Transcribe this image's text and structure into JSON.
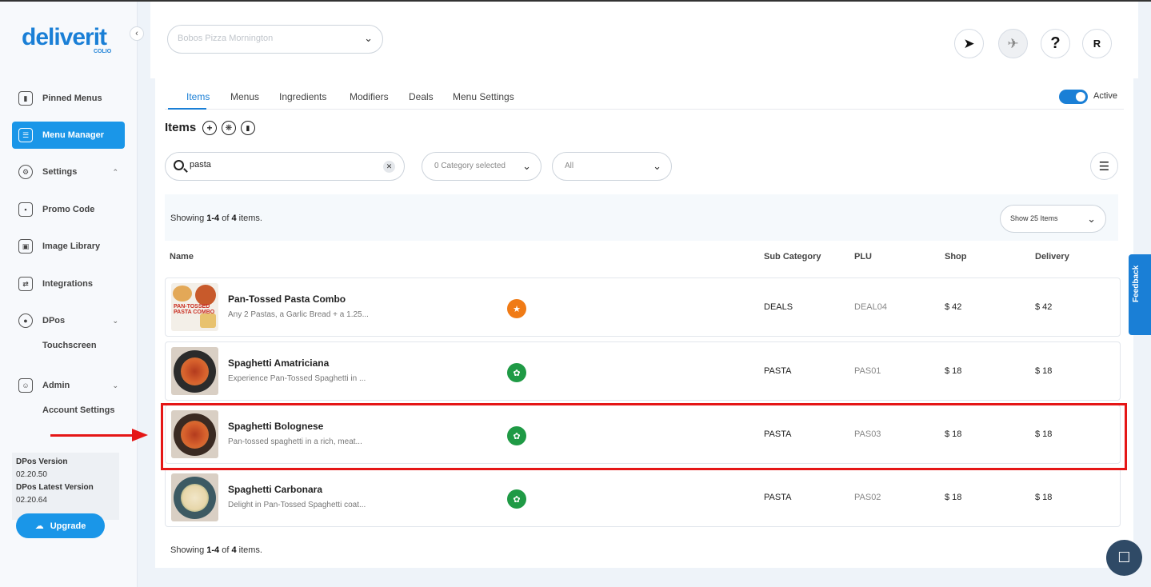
{
  "brand": {
    "logo_text": "deliverit",
    "logo_sub": "COLIO"
  },
  "sidebar": {
    "items": [
      {
        "label": "Pinned Menus",
        "icon": "bookmark-icon"
      },
      {
        "label": "Menu Manager",
        "icon": "menu-icon",
        "active": true
      },
      {
        "label": "Settings",
        "icon": "gear-icon"
      },
      {
        "label": "Promo Code",
        "icon": "tag-icon"
      },
      {
        "label": "Image Library",
        "icon": "image-icon"
      },
      {
        "label": "Integrations",
        "icon": "plug-icon"
      },
      {
        "label": "DPos",
        "icon": "pos-icon"
      },
      {
        "label": "Admin",
        "icon": "user-icon"
      }
    ],
    "sub_touchscreen": "Touchscreen",
    "sub_account_settings": "Account Settings",
    "version_label": "DPos Version",
    "version_value": "02.20.50",
    "latest_label": "DPos Latest Version",
    "latest_value": "02.20.64",
    "upgrade_label": "Upgrade"
  },
  "header": {
    "store_select_value": "Bobos Pizza Mornington",
    "user_initial": "R",
    "help_label": "?"
  },
  "tabs": [
    "Items",
    "Menus",
    "Ingredients",
    "Modifiers",
    "Deals",
    "Menu Settings"
  ],
  "active_toggle_label": "Active",
  "items_title": "Items",
  "search": {
    "value": "pasta"
  },
  "filters": {
    "category": "0 Category selected",
    "status": "All"
  },
  "showing": {
    "prefix": "Showing ",
    "range": "1-4",
    "middle": " of ",
    "total": "4",
    "suffix": " items."
  },
  "page_size": "Show 25 Items",
  "columns": {
    "name": "Name",
    "sub_category": "Sub Category",
    "plu": "PLU",
    "shop": "Shop",
    "delivery": "Delivery"
  },
  "rows": [
    {
      "name": "Pan-Tossed Pasta Combo",
      "desc": "Any 2 Pastas, a Garlic Bread + a 1.25...",
      "sub_category": "DEALS",
      "plu": "DEAL04",
      "shop": "$ 42",
      "delivery": "$ 42",
      "badge": "deal-tag-icon"
    },
    {
      "name": "Spaghetti Amatriciana",
      "desc": "Experience Pan-Tossed Spaghetti in ...",
      "sub_category": "PASTA",
      "plu": "PAS01",
      "shop": "$ 18",
      "delivery": "$ 18",
      "badge": "leaf-icon"
    },
    {
      "name": "Spaghetti Bolognese",
      "desc": "Pan-tossed spaghetti in a rich, meat...",
      "sub_category": "PASTA",
      "plu": "PAS03",
      "shop": "$ 18",
      "delivery": "$ 18",
      "badge": "leaf-icon"
    },
    {
      "name": "Spaghetti Carbonara",
      "desc": "Delight in Pan-Tossed Spaghetti coat...",
      "sub_category": "PASTA",
      "plu": "PAS02",
      "shop": "$ 18",
      "delivery": "$ 18",
      "badge": "leaf-icon"
    }
  ],
  "combo_image_text": "PAN-TOSSED PASTA COMBO",
  "feedback_label": "Feedback",
  "colors": {
    "accent": "#1a7fd6",
    "highlight": "#e51616",
    "deal_badge": "#f07b16",
    "veg_badge": "#1f9a45"
  }
}
